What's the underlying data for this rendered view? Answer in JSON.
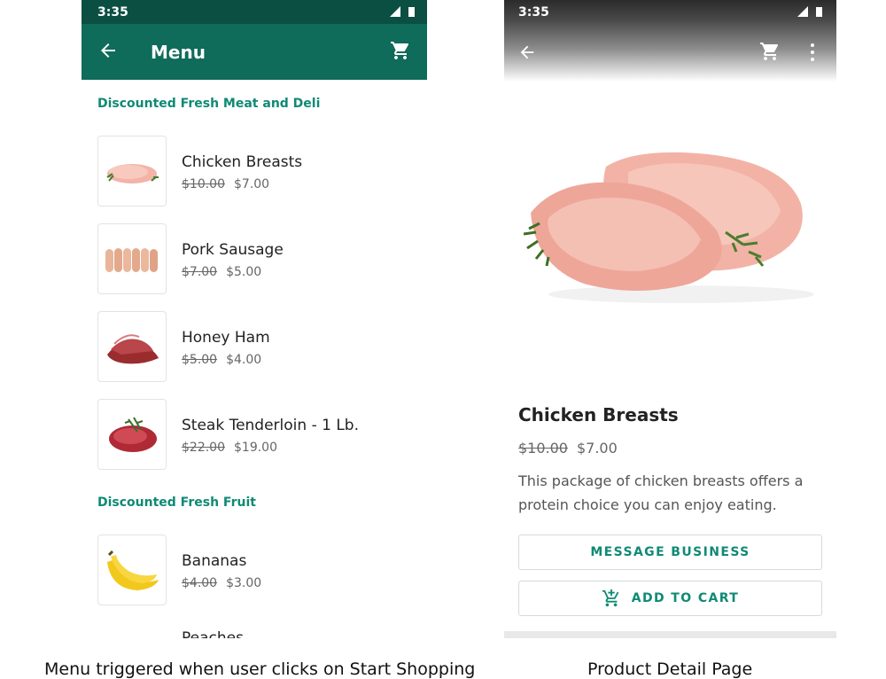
{
  "menu_screen": {
    "status_time": "3:35",
    "title": "Menu",
    "sections": [
      {
        "heading": "Discounted Fresh Meat and Deli",
        "items": [
          {
            "name": "Chicken Breasts",
            "old_price": "$10.00",
            "price": "$7.00"
          },
          {
            "name": "Pork Sausage",
            "old_price": "$7.00",
            "price": "$5.00"
          },
          {
            "name": "Honey Ham",
            "old_price": "$5.00",
            "price": "$4.00"
          },
          {
            "name": "Steak Tenderloin - 1 Lb.",
            "old_price": "$22.00",
            "price": "$19.00"
          }
        ]
      },
      {
        "heading": "Discounted Fresh Fruit",
        "items": [
          {
            "name": "Bananas",
            "old_price": "$4.00",
            "price": "$3.00"
          },
          {
            "name": "Peaches"
          }
        ]
      }
    ]
  },
  "detail_screen": {
    "status_time": "3:35",
    "product_name": "Chicken Breasts",
    "old_price": "$10.00",
    "price": "$7.00",
    "description": "This package of chicken breasts offers a protein choice you can enjoy eating.",
    "message_button_label": "MESSAGE BUSINESS",
    "add_to_cart_label": "ADD TO CART"
  },
  "captions": {
    "left": "Menu triggered when user clicks on Start Shopping",
    "right": "Product Detail Page"
  },
  "colors": {
    "appbar": "#0f6b5a",
    "status_bar": "#0b4f43",
    "accent": "#0f8a74"
  },
  "icons": [
    "back-arrow-icon",
    "shopping-cart-icon",
    "more-vert-icon",
    "add-shopping-cart-icon",
    "signal-icon",
    "battery-icon"
  ]
}
